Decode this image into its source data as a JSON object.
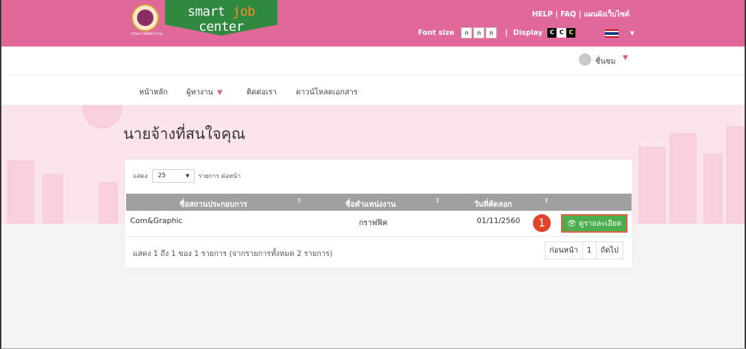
{
  "header": {
    "brand_prefix": "smart ",
    "brand_job": "job",
    "brand_suffix": " center",
    "emblem_text": "กรมการจัดหางาน",
    "links": "HELP | FAQ | แผนผังเว็บไซต์",
    "font_size_label": "Font size",
    "font_size_buttons": [
      "ก",
      "ก",
      "ก"
    ],
    "sep": "|",
    "display_label": "Display",
    "display_buttons": [
      "C",
      "C",
      "C"
    ],
    "language_flag_icon": "thai-flag",
    "colors": {
      "topbar": "#e0699a",
      "brand_green": "#2f8a3f",
      "job_orange": "#ff8a2b"
    }
  },
  "user": {
    "name": "ชื่นชม"
  },
  "nav": {
    "items": [
      {
        "label": "หน้าหลัก"
      },
      {
        "label": "ผู้หางาน"
      },
      {
        "label": "ติดต่อเรา"
      },
      {
        "label": "ดาวน์โหลดเอกสาร"
      }
    ]
  },
  "page": {
    "title": "นายจ้างที่สนใจคุณ"
  },
  "table": {
    "length_prefix": "แสดง",
    "length_value": "25",
    "length_suffix": "รายการ ต่อหน้า",
    "columns": [
      "ชื่อสถานประกอบการ",
      "ชื่อตำแหน่งงาน",
      "วันที่คัดลอก"
    ],
    "rows": [
      {
        "company": "Com&Graphic",
        "position": "กราฟฟิค",
        "date": "01/11/2560",
        "action": "ดูรายละเอียด"
      }
    ],
    "info": "แสดง 1 ถึง 1 ของ 1 รายการ (จากรายการทั้งหมด 2 รายการ)",
    "pager": {
      "prev": "ก่อนหน้า",
      "page": "1",
      "next": "ถัดไป"
    }
  },
  "annotation": {
    "step": "1"
  }
}
